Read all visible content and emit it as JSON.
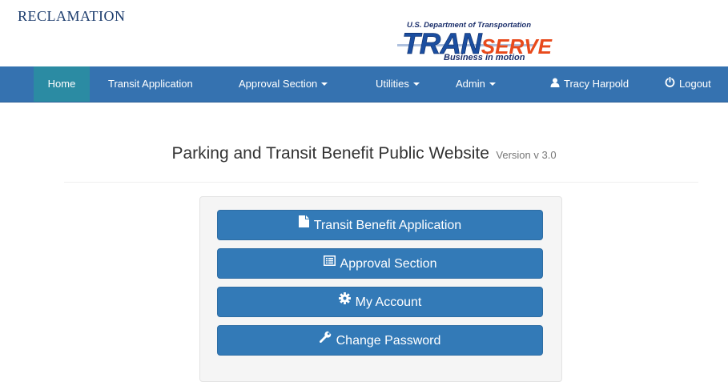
{
  "header": {
    "org_name": "RECLAMATION",
    "brand": {
      "department": "U.S. Department of Transportation",
      "name_part1": "TRAN",
      "name_part2": "SERVE",
      "tagline": "Business in motion"
    }
  },
  "navbar": {
    "items": [
      {
        "label": "Home",
        "active": true
      },
      {
        "label": "Transit Application",
        "dropdown": false
      },
      {
        "label": "Approval Section",
        "dropdown": true
      },
      {
        "label": "Utilities",
        "dropdown": true
      },
      {
        "label": "Admin",
        "dropdown": true
      }
    ],
    "user": {
      "label": "Tracy Harpold",
      "icon": "user-icon"
    },
    "logout": {
      "label": "Logout",
      "icon": "power-icon"
    },
    "colors": {
      "bar": "#3572b0",
      "active": "#2b8ba3"
    }
  },
  "main": {
    "title": "Parking and Transit Benefit Public Website",
    "version": "Version v 3.0",
    "buttons": [
      {
        "label": "Transit Benefit Application",
        "icon": "file-icon"
      },
      {
        "label": "Approval Section",
        "icon": "list-alt-icon"
      },
      {
        "label": "My Account",
        "icon": "gear-icon"
      },
      {
        "label": "Change Password",
        "icon": "wrench-icon"
      }
    ],
    "button_color": "#337ab7"
  }
}
